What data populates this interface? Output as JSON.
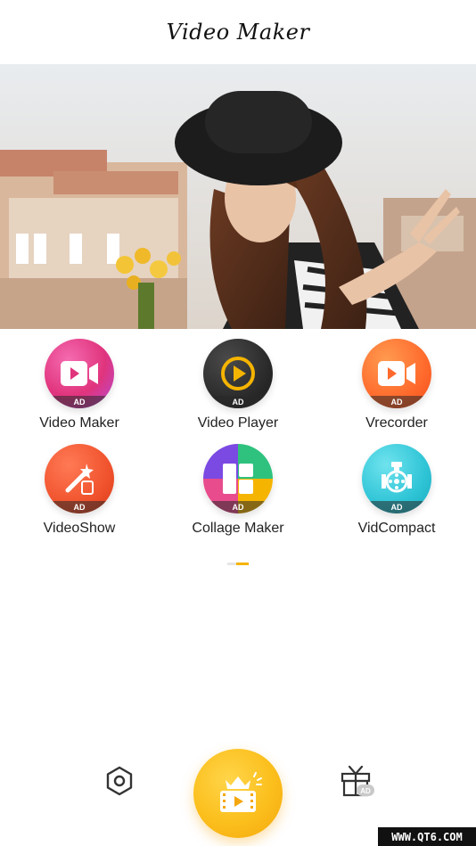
{
  "header": {
    "title": "Video Maker"
  },
  "apps": [
    {
      "label": "Video Maker",
      "badge": "AD",
      "icon": "video-camera-icon",
      "color": "#e84c8c"
    },
    {
      "label": "Video Player",
      "badge": "AD",
      "icon": "play-icon",
      "color": "#2b2b2b"
    },
    {
      "label": "Vrecorder",
      "badge": "AD",
      "icon": "video-camera-icon",
      "color": "#ff6a2c"
    },
    {
      "label": "VideoShow",
      "badge": "AD",
      "icon": "magic-wand-film-icon",
      "color": "#f0532d"
    },
    {
      "label": "Collage Maker",
      "badge": "AD",
      "icon": "collage-grid-icon",
      "color": "#8e44ad"
    },
    {
      "label": "VidCompact",
      "badge": "AD",
      "icon": "film-reel-icon",
      "color": "#2ec4d6"
    }
  ],
  "bottom_nav": {
    "settings_icon": "settings-icon",
    "main_icon": "crown-film-icon",
    "gift_icon": "gift-icon",
    "gift_badge": "AD"
  },
  "watermark": "WWW.QT6.COM",
  "colors": {
    "accent": "#fbbf1c",
    "pager_active": "#f5b400"
  }
}
